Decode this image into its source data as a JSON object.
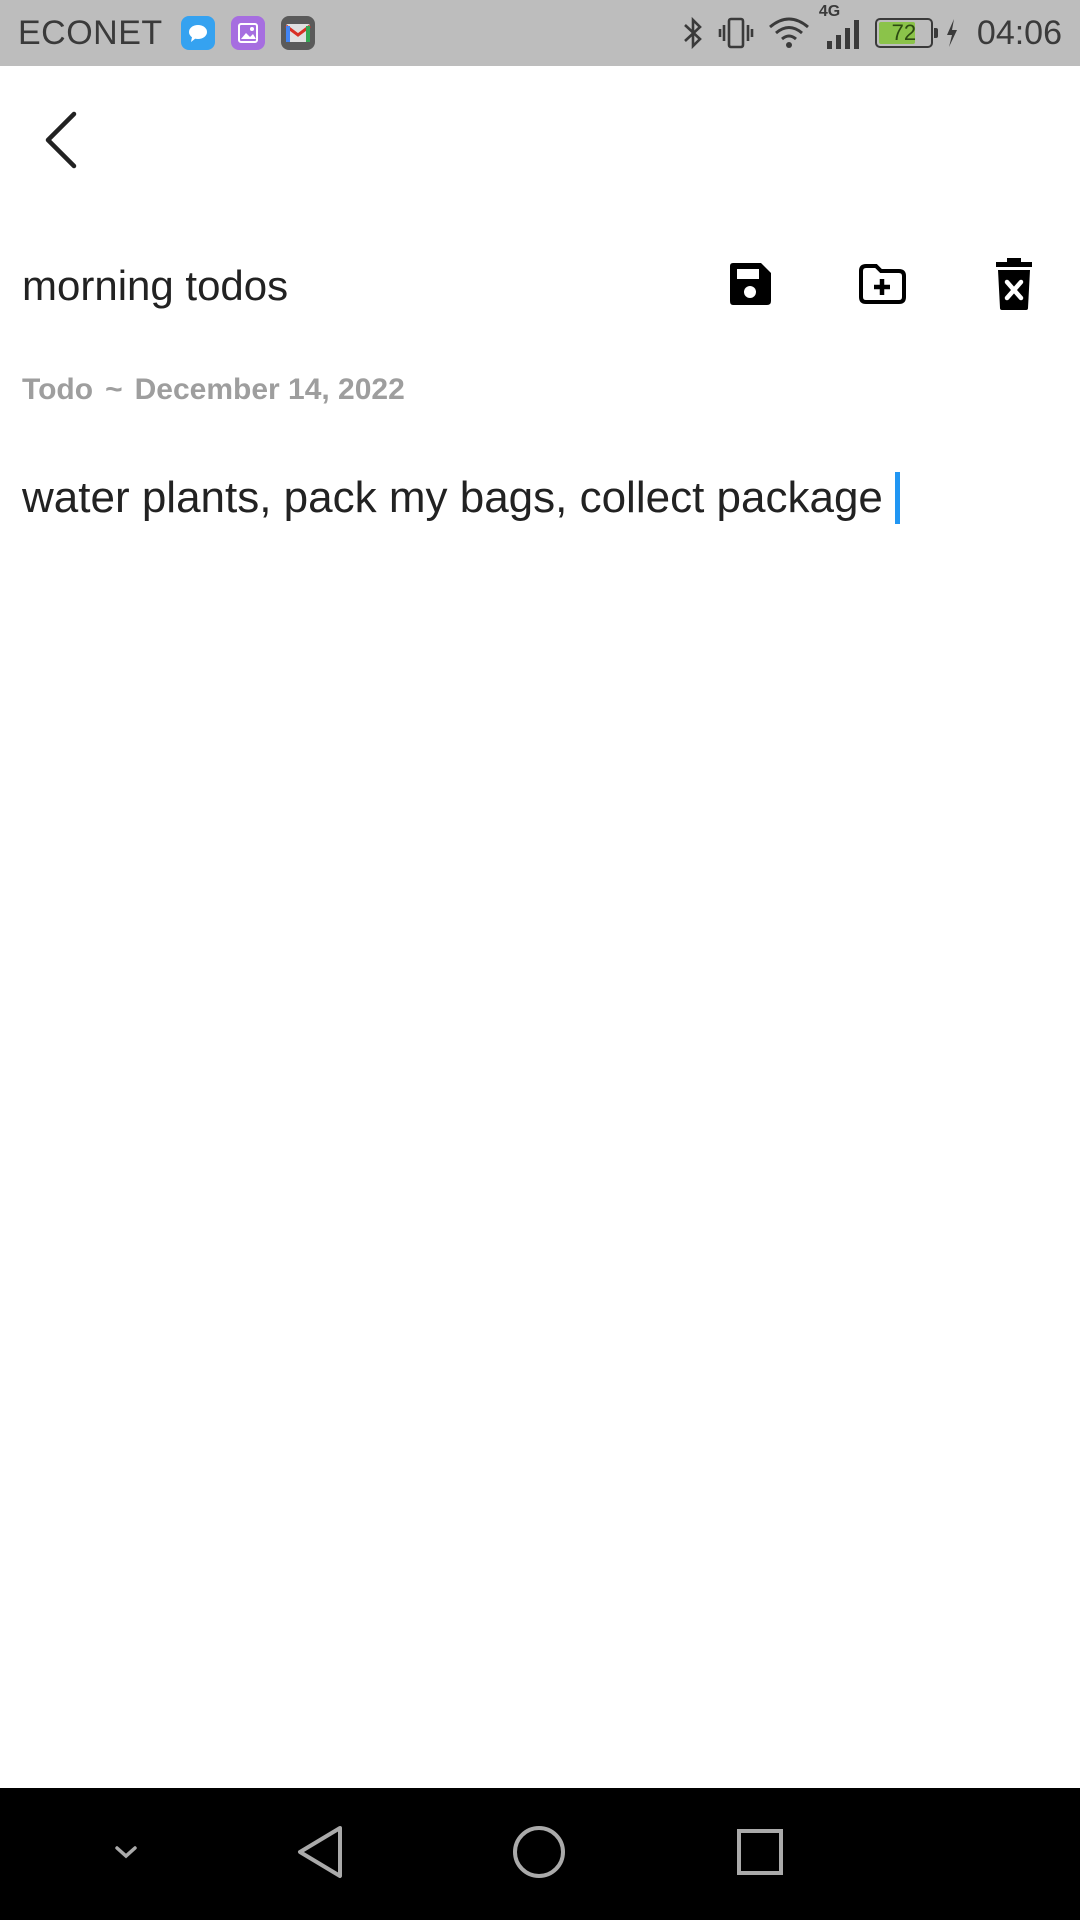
{
  "status_bar": {
    "carrier": "ECONET",
    "network_type": "4G",
    "battery_level": "72",
    "battery_fraction": 0.72,
    "time": "04:06",
    "icons": [
      "messages-icon",
      "gallery-icon",
      "gmail-icon",
      "bluetooth-icon",
      "vibrate-icon",
      "wifi-icon",
      "signal-icon",
      "battery-icon",
      "charging-icon"
    ]
  },
  "toolbar": {
    "back_icon": "back-arrow-icon"
  },
  "note": {
    "title": "morning todos",
    "category": "Todo",
    "separator": "~",
    "date": "December 14, 2022",
    "content": "water plants, pack my bags, collect package"
  },
  "actions": [
    {
      "name": "save-button",
      "icon": "save-icon"
    },
    {
      "name": "add-folder-button",
      "icon": "folder-plus-icon"
    },
    {
      "name": "delete-button",
      "icon": "trash-icon"
    }
  ],
  "colors": {
    "status_bar": "#bdbdbd",
    "meta_text": "#9e9e9e",
    "cursor": "#2196f3",
    "battery_fill": "#8bc34a",
    "nav_bar": "#000000"
  },
  "nav_bar": {
    "items": [
      "collapse-icon",
      "back-triangle-icon",
      "home-circle-icon",
      "recents-square-icon"
    ]
  }
}
